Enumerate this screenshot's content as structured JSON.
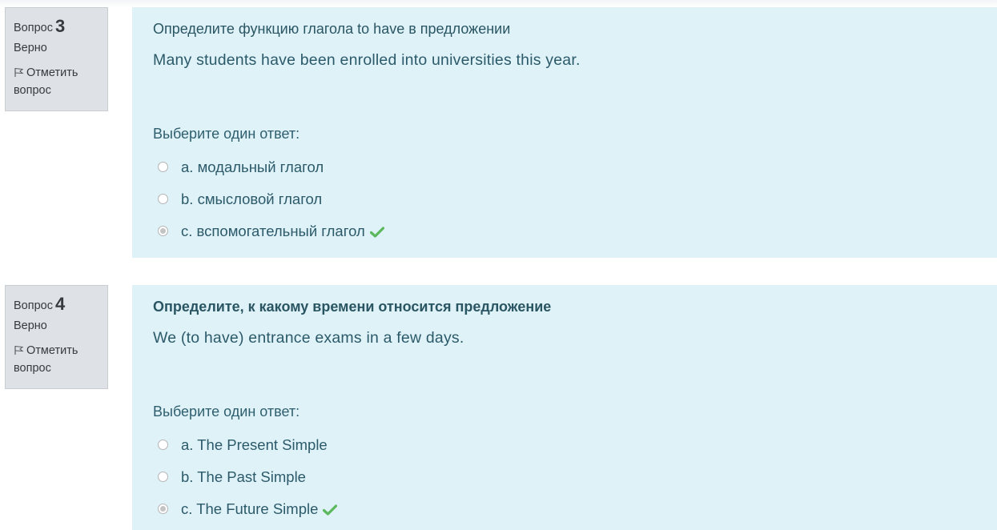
{
  "questions": [
    {
      "label": "Вопрос",
      "number": "3",
      "state": "Верно",
      "flag_label": "Отметить вопрос",
      "prompt": "Определите функцию глагола to have в предложении",
      "sentence": "Many students have been enrolled into universities this year.",
      "choose_label": "Выберите один ответ:",
      "options": [
        {
          "letter": "a.",
          "text": "модальный глагол"
        },
        {
          "letter": "b.",
          "text": "смысловой глагол"
        },
        {
          "letter": "c.",
          "text": "вспомогательный глагол"
        }
      ],
      "selected_option": "c.",
      "correct": true
    },
    {
      "label": "Вопрос",
      "number": "4",
      "state": "Верно",
      "flag_label": "Отметить вопрос",
      "prompt": "Определите, к какому времени относится предложение",
      "sentence": "We (to have) entrance exams in a few days.",
      "choose_label": "Выберите один ответ:",
      "options": [
        {
          "letter": "a.",
          "text": "The Present Simple"
        },
        {
          "letter": "b.",
          "text": "The Past Simple"
        },
        {
          "letter": "c.",
          "text": "The Future Simple"
        }
      ],
      "selected_option": "c.",
      "correct": true
    }
  ],
  "icons": {
    "flag": "flag-icon",
    "check": "checkmark-icon"
  },
  "colors": {
    "content_bg": "#def2f8",
    "info_bg": "#dee2e6",
    "text": "#2c5a6a",
    "correct_check": "#5cb85c"
  }
}
